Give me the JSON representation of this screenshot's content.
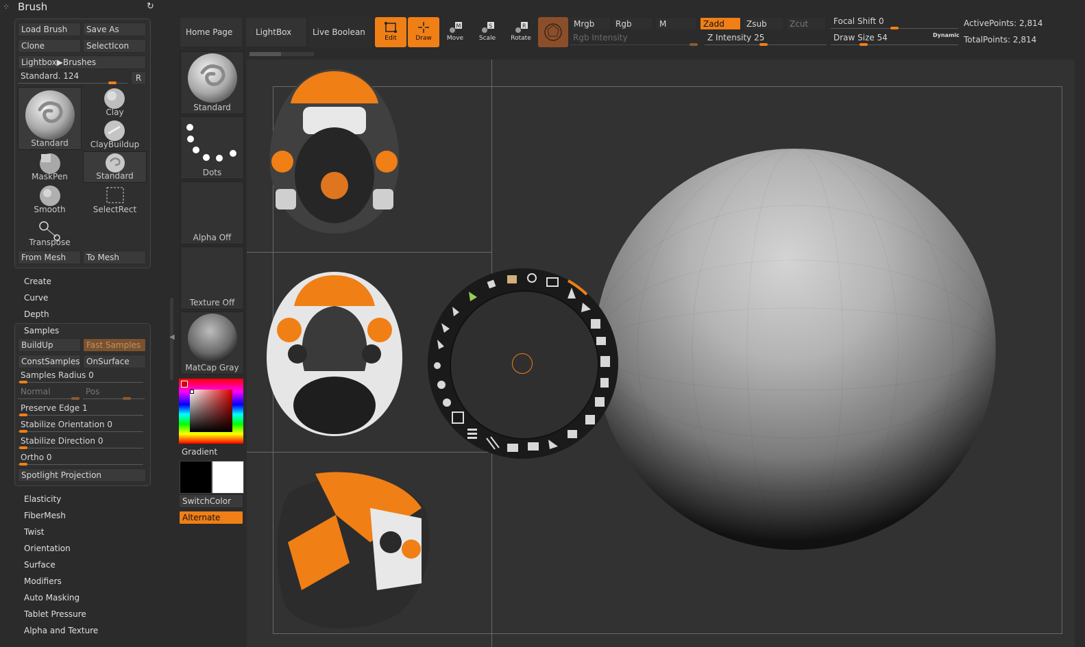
{
  "brush_panel": {
    "title": "Brush",
    "load_brush": "Load Brush",
    "save_as": "Save As",
    "clone": "Clone",
    "select_icon": "SelectIcon",
    "lightbox_brushes": "Lightbox▶Brushes",
    "current_brush_label": "Standard. 124",
    "r_button": "R",
    "brushes": [
      "Standard",
      "Clay",
      "ClayBuildup",
      "MaskPen",
      "Standard",
      "Smooth",
      "SelectRect",
      "Transpose"
    ],
    "from_mesh": "From Mesh",
    "to_mesh": "To Mesh"
  },
  "brush_sections_top": [
    "Create",
    "Curve",
    "Depth"
  ],
  "samples": {
    "title": "Samples",
    "buildup": "BuildUp",
    "fast_samples": "Fast Samples",
    "const_samples": "ConstSamples",
    "on_surface": "OnSurface",
    "samples_radius": "Samples Radius 0",
    "normal": "Normal",
    "pos": "Pos",
    "preserve_edge": "Preserve Edge 1",
    "stabilize_orientation": "Stabilize Orientation 0",
    "stabilize_direction": "Stabilize Direction 0",
    "ortho": "Ortho 0",
    "spotlight_projection": "Spotlight Projection"
  },
  "brush_sections_bottom": [
    "Elasticity",
    "FiberMesh",
    "Twist",
    "Orientation",
    "Surface",
    "Modifiers",
    "Auto Masking",
    "Tablet Pressure",
    "Alpha and Texture"
  ],
  "shelf": {
    "brush": "Standard",
    "stroke": "Dots",
    "alpha": "Alpha Off",
    "texture": "Texture Off",
    "material": "MatCap Gray",
    "gradient": "Gradient",
    "switch_color": "SwitchColor",
    "alternate": "Alternate"
  },
  "top_bar": {
    "home_page": "Home Page",
    "lightbox": "LightBox",
    "live_boolean": "Live Boolean",
    "tools": [
      "Edit",
      "Draw",
      "Move",
      "Scale",
      "Rotate"
    ],
    "mrgb": "Mrgb",
    "rgb": "Rgb",
    "m": "M",
    "rgb_intensity": "Rgb Intensity",
    "zadd": "Zadd",
    "zsub": "Zsub",
    "zcut": "Zcut",
    "z_intensity": "Z Intensity 25",
    "focal_shift": "Focal Shift 0",
    "draw_size": "Draw Size 54",
    "dynamic": "Dynamic",
    "active_points": "ActivePoints: 2,814",
    "total_points": "TotalPoints: 2,814"
  },
  "colors": {
    "accent": "#f07f16",
    "background": "#2b2b2b",
    "panel": "#3a3a3a"
  }
}
